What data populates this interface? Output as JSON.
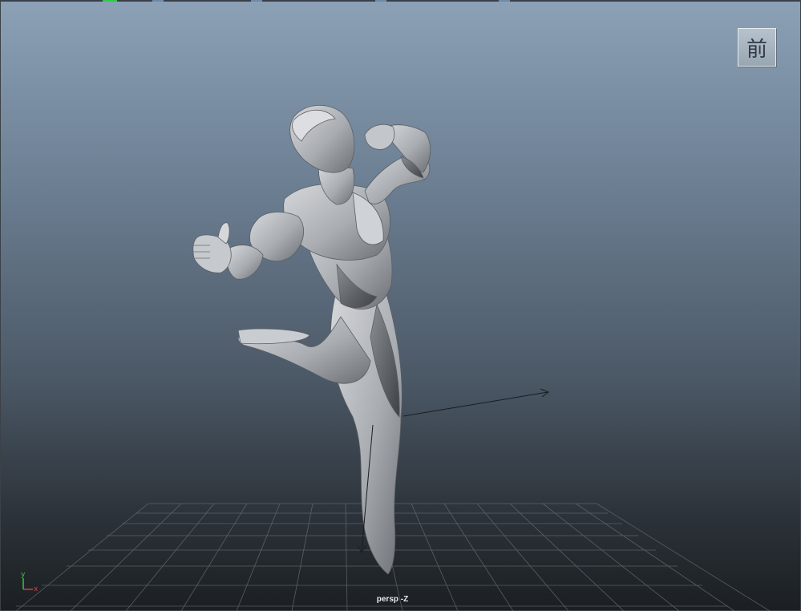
{
  "viewport": {
    "camera_label": "persp -Z",
    "view_cube_label": "前",
    "axis_gizmo": {
      "y_label": "y",
      "x_label": "x"
    },
    "colors": {
      "grid": "#6b7178",
      "mesh": "#b5b8bc",
      "axis_y": "#33d04a",
      "axis_x": "#e0403a"
    }
  },
  "icons": [
    "view-cube-icon",
    "axis-gizmo-icon",
    "manipulator-arrow-icon"
  ]
}
